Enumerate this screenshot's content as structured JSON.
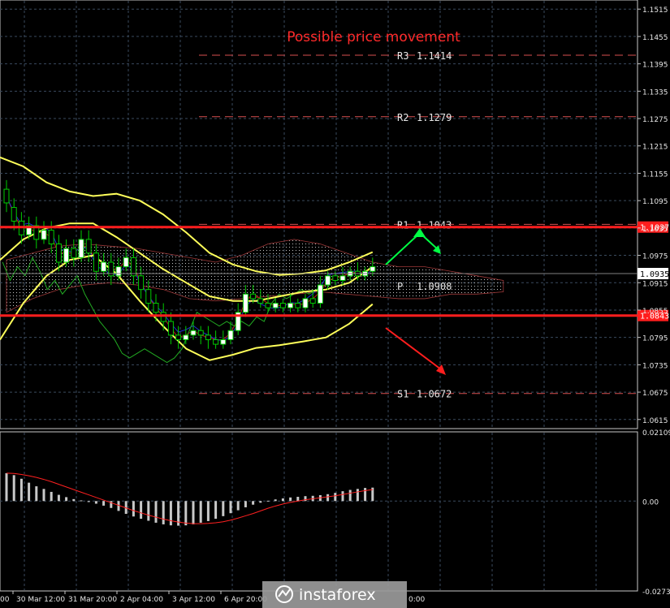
{
  "title": "Possible price movement",
  "chart_data": [
    {
      "type": "candlestick",
      "name": "price",
      "ylim": [
        1.0595,
        1.1535
      ],
      "y_ticks": [
        "1.1515",
        "1.1455",
        "1.1395",
        "1.1335",
        "1.1275",
        "1.1215",
        "1.1155",
        "1.1095",
        "1.1035",
        "1.0975",
        "1.0915",
        "1.0855",
        "1.0795",
        "1.0735",
        "1.0675",
        "1.0615"
      ],
      "pivots": [
        {
          "label": "R3",
          "value": "1.1414",
          "v": 1.1414
        },
        {
          "label": "R2",
          "value": "1.1279",
          "v": 1.1279
        },
        {
          "label": "R1",
          "value": "1.1043",
          "v": 1.1043
        },
        {
          "label": "P",
          "value": "1.0908",
          "v": 1.0908
        },
        {
          "label": "S1",
          "value": "1.0672",
          "v": 1.0672
        }
      ],
      "red_levels": [
        {
          "label": "1.1037",
          "v": 1.1037
        },
        {
          "label": "1.0843",
          "v": 1.0843
        }
      ],
      "current_price": {
        "label": "1.0935",
        "v": 1.0935
      },
      "bollinger_upper": [
        1.119,
        1.117,
        1.1135,
        1.1115,
        1.1105,
        1.111,
        1.1095,
        1.1065,
        1.1025,
        1.098,
        1.0955,
        1.094,
        1.0932,
        1.0935,
        1.0942,
        1.096,
        1.0982
      ],
      "bollinger_middle": [
        1.0965,
        1.101,
        1.1035,
        1.1045,
        1.1045,
        1.1015,
        1.098,
        1.0945,
        1.0915,
        1.0885,
        1.0875,
        1.0875,
        1.0885,
        1.0895,
        1.09,
        1.0915,
        1.095
      ],
      "bollinger_lower": [
        1.079,
        1.087,
        1.093,
        1.0965,
        1.0975,
        1.0935,
        1.0875,
        1.082,
        1.077,
        1.0745,
        1.0757,
        1.0772,
        1.0778,
        1.0786,
        1.0795,
        1.0825,
        1.0868
      ],
      "candles": [
        [
          1.112,
          1.109,
          1.114,
          1.107
        ],
        [
          1.108,
          1.105,
          1.11,
          1.103
        ],
        [
          1.105,
          1.102,
          1.107,
          1.1
        ],
        [
          1.102,
          1.104,
          1.106,
          1.101
        ],
        [
          1.104,
          1.101,
          1.106,
          1.099
        ],
        [
          1.101,
          1.103,
          1.105,
          1.1
        ],
        [
          1.103,
          1.1,
          1.105,
          1.098
        ],
        [
          1.1,
          1.096,
          1.102,
          1.094
        ],
        [
          1.096,
          1.099,
          1.101,
          1.095
        ],
        [
          1.099,
          1.097,
          1.101,
          1.095
        ],
        [
          1.097,
          1.101,
          1.103,
          1.096
        ],
        [
          1.101,
          1.098,
          1.103,
          1.096
        ],
        [
          1.098,
          1.094,
          1.1,
          1.092
        ],
        [
          1.094,
          1.096,
          1.098,
          1.093
        ],
        [
          1.096,
          1.093,
          1.098,
          1.091
        ],
        [
          1.093,
          1.095,
          1.097,
          1.092
        ],
        [
          1.095,
          1.097,
          1.099,
          1.094
        ],
        [
          1.097,
          1.093,
          1.099,
          1.091
        ],
        [
          1.093,
          1.09,
          1.095,
          1.088
        ],
        [
          1.09,
          1.087,
          1.092,
          1.085
        ],
        [
          1.087,
          1.085,
          1.089,
          1.083
        ],
        [
          1.085,
          1.083,
          1.087,
          1.081
        ],
        [
          1.083,
          1.08,
          1.085,
          1.078
        ],
        [
          1.08,
          1.079,
          1.082,
          1.077
        ],
        [
          1.079,
          1.08,
          1.082,
          1.078
        ],
        [
          1.08,
          1.081,
          1.083,
          1.079
        ],
        [
          1.081,
          1.08,
          1.082,
          1.078
        ],
        [
          1.08,
          1.079,
          1.082,
          1.077
        ],
        [
          1.079,
          1.078,
          1.081,
          1.077
        ],
        [
          1.078,
          1.079,
          1.081,
          1.077
        ],
        [
          1.079,
          1.081,
          1.083,
          1.078
        ],
        [
          1.081,
          1.085,
          1.087,
          1.08
        ],
        [
          1.085,
          1.089,
          1.091,
          1.084
        ],
        [
          1.089,
          1.088,
          1.091,
          1.087
        ],
        [
          1.088,
          1.087,
          1.09,
          1.086
        ],
        [
          1.087,
          1.086,
          1.089,
          1.085
        ],
        [
          1.086,
          1.087,
          1.088,
          1.085
        ],
        [
          1.087,
          1.086,
          1.088,
          1.085
        ],
        [
          1.086,
          1.087,
          1.089,
          1.085
        ],
        [
          1.087,
          1.086,
          1.088,
          1.085
        ],
        [
          1.086,
          1.088,
          1.089,
          1.085
        ],
        [
          1.088,
          1.087,
          1.09,
          1.086
        ],
        [
          1.087,
          1.091,
          1.093,
          1.086
        ],
        [
          1.091,
          1.093,
          1.094,
          1.09
        ],
        [
          1.093,
          1.092,
          1.094,
          1.091
        ],
        [
          1.092,
          1.093,
          1.095,
          1.091
        ],
        [
          1.093,
          1.094,
          1.095,
          1.092
        ],
        [
          1.094,
          1.093,
          1.096,
          1.092
        ],
        [
          1.093,
          1.094,
          1.095,
          1.092
        ],
        [
          1.094,
          1.095,
          1.097,
          1.093
        ]
      ]
    },
    {
      "type": "bar",
      "name": "oscillator",
      "ylim": [
        -0.02739,
        0.02109
      ],
      "y_ticks": [
        "0.02109",
        "0.00",
        "-0.02739"
      ],
      "values": [
        0.0085,
        0.0079,
        0.0068,
        0.0056,
        0.0045,
        0.0037,
        0.0028,
        0.0019,
        0.0012,
        0.0006,
        0.0002,
        -0.0003,
        -0.0008,
        -0.0014,
        -0.0021,
        -0.003,
        -0.0039,
        -0.0047,
        -0.0054,
        -0.006,
        -0.0066,
        -0.0071,
        -0.0074,
        -0.0075,
        -0.0074,
        -0.0071,
        -0.0066,
        -0.0061,
        -0.0054,
        -0.0046,
        -0.0037,
        -0.0028,
        -0.0019,
        -0.0011,
        -0.0005,
        0.0001,
        0.0005,
        0.0008,
        0.0011,
        0.0013,
        0.0015,
        0.0016,
        0.0018,
        0.0021,
        0.0025,
        0.003,
        0.0034,
        0.0037,
        0.004,
        0.0041
      ],
      "signal": [
        0.0085,
        0.0084,
        0.0081,
        0.0077,
        0.0072,
        0.0066,
        0.0059,
        0.0051,
        0.0043,
        0.0035,
        0.0027,
        0.0019,
        0.0011,
        0.0003,
        -0.0005,
        -0.0013,
        -0.0021,
        -0.0029,
        -0.0036,
        -0.0043,
        -0.0049,
        -0.0055,
        -0.006,
        -0.0064,
        -0.0067,
        -0.0069,
        -0.0069,
        -0.0068,
        -0.0066,
        -0.0063,
        -0.0058,
        -0.0052,
        -0.0045,
        -0.0038,
        -0.003,
        -0.0022,
        -0.0015,
        -0.0009,
        -0.0004,
        0.0,
        0.0004,
        0.0007,
        0.001,
        0.0013,
        0.0016,
        0.002,
        0.0024,
        0.0028,
        0.0032,
        0.0035
      ]
    }
  ],
  "x_labels": [
    "30 Mar 12:00",
    "31 Mar 20:00",
    "2 Apr 04:00",
    "3 Apr 12:00",
    "6 Apr 20:00"
  ],
  "x_label_left_partial": "00",
  "x_label_right_partial": "0:00",
  "colors": {
    "background": "#000000",
    "grid": "#3a4a5e",
    "axis_text": "#e6e6e6",
    "title": "#ff2a2a",
    "pivot_line": "#d85050",
    "red_level": "#ff1e1e",
    "bollinger": "#ffff5a",
    "candle_up": "#ffffff",
    "candle_down": "#00cc00",
    "histogram": "#c8c8c8",
    "signal": "#ff2020",
    "arrow_up": "#00ff44",
    "arrow_down": "#ff1e1e"
  },
  "watermark": {
    "text": "instaforex"
  }
}
